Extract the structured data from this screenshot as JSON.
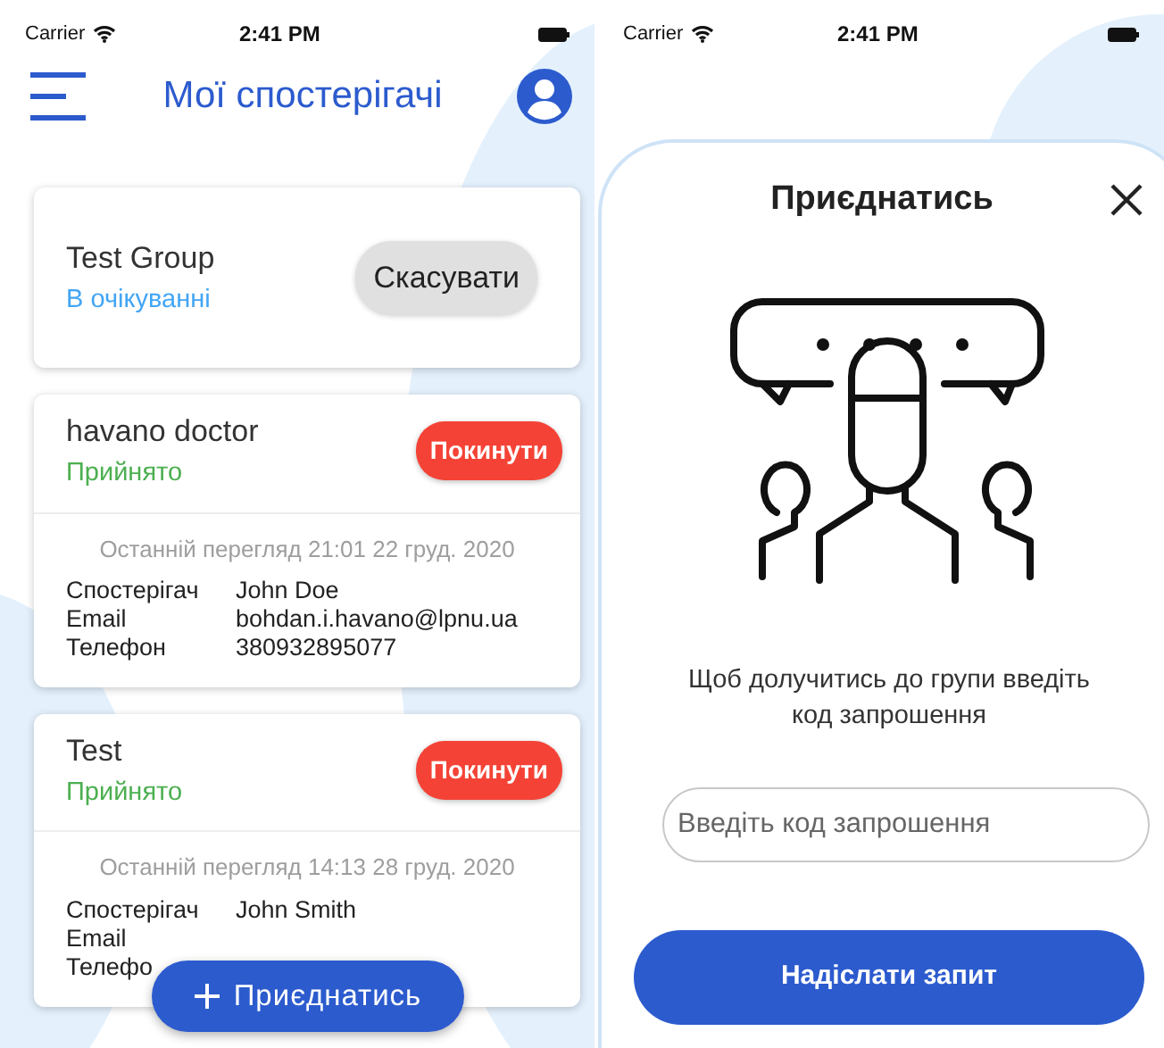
{
  "left_screen": {
    "status_bar": {
      "carrier": "Carrier",
      "time": "2:41 PM"
    },
    "header": {
      "title": "Мої спостерігачі"
    },
    "groups": [
      {
        "name": "Test Group",
        "status": "В очікуванні",
        "kind": "pending",
        "action": "Скасувати"
      },
      {
        "name": "havano doctor",
        "status": "Прийнято",
        "kind": "accepted",
        "action": "Покинути",
        "last_seen": "Останній перегляд 21:01 22 груд. 2020",
        "details": [
          {
            "label": "Спостерігач",
            "value": "John Doe"
          },
          {
            "label": "Email",
            "value": "bohdan.i.havano@lpnu.ua"
          },
          {
            "label": "Телефон",
            "value": "380932895077"
          }
        ]
      },
      {
        "name": "Test",
        "status": "Прийнято",
        "kind": "accepted",
        "action": "Покинути",
        "last_seen": "Останній перегляд 14:13 28 груд. 2020",
        "details": [
          {
            "label": "Спостерігач",
            "value": "John Smith"
          },
          {
            "label": "Email"
          },
          {
            "label": "Телефо"
          }
        ]
      }
    ],
    "fab": {
      "label": "Приєднатись"
    }
  },
  "right_screen": {
    "status_bar": {
      "carrier": "Carrier",
      "time": "2:41 PM"
    },
    "dialog": {
      "title": "Приєднатись",
      "message": "Щоб долучитись до групи введіть код запрошення",
      "input": {
        "placeholder": "Введіть код запрошення"
      },
      "submit": "Надіслати запит"
    }
  }
}
